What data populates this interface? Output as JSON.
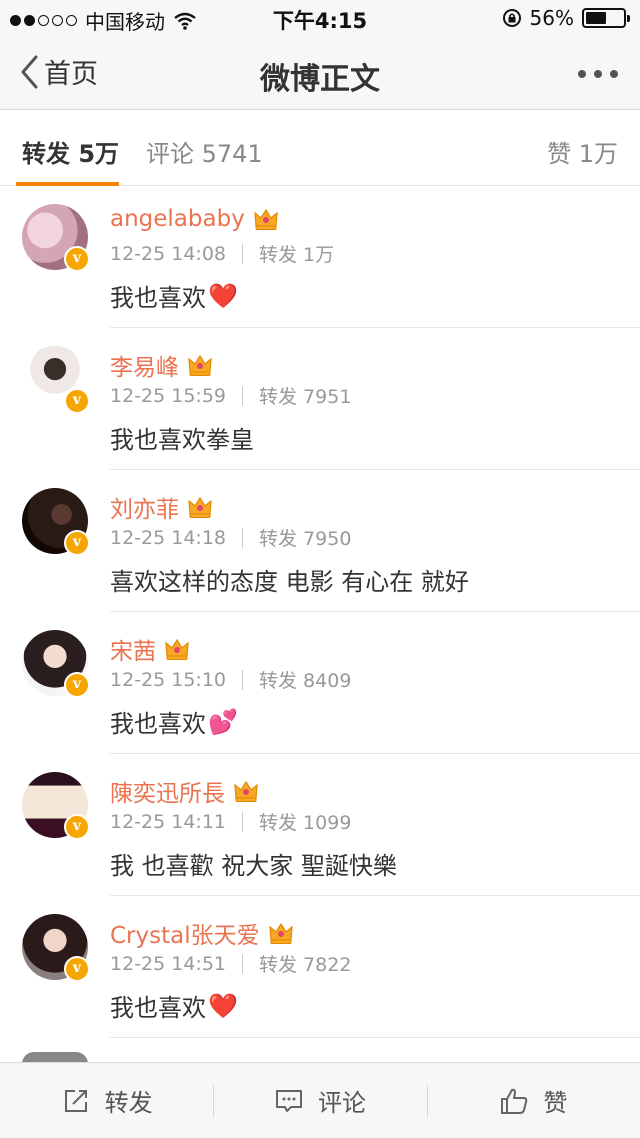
{
  "status_bar": {
    "carrier": "中国移动",
    "time": "下午4:15",
    "battery": "56%",
    "battery_level": 0.56
  },
  "nav": {
    "back_label": "首页",
    "title": "微博正文"
  },
  "tabs": [
    {
      "label": "转发 5万"
    },
    {
      "label": "评论 5741"
    },
    {
      "label": "赞 1万"
    }
  ],
  "reposts": [
    {
      "name": "angelababy",
      "time": "12-25 14:08",
      "count": "转发 1万",
      "text": "我也喜欢",
      "emoji": "❤️"
    },
    {
      "name": "李易峰",
      "time": "12-25 15:59",
      "count": "转发 7951",
      "text": "我也喜欢拳皇",
      "emoji": ""
    },
    {
      "name": "刘亦菲",
      "time": "12-25 14:18",
      "count": "转发 7950",
      "text": "喜欢这样的态度 电影 有心在 就好",
      "emoji": ""
    },
    {
      "name": "宋茜",
      "time": "12-25 15:10",
      "count": "转发 8409",
      "text": "我也喜欢",
      "emoji": "💕"
    },
    {
      "name": "陳奕迅所長",
      "time": "12-25 14:11",
      "count": "转发 1099",
      "text": "我  也喜歡 祝大家 聖誕快樂",
      "emoji": ""
    },
    {
      "name": "Crystal张天爱",
      "time": "12-25 14:51",
      "count": "转发 7822",
      "text": "我也喜欢",
      "emoji": "❤️"
    }
  ],
  "toolbar": {
    "repost_label": "转发",
    "comment_label": "评论",
    "like_label": "赞"
  },
  "colors": {
    "accent": "#ff8200",
    "username": "#eb7350",
    "verified_badge": "#f7a500"
  }
}
